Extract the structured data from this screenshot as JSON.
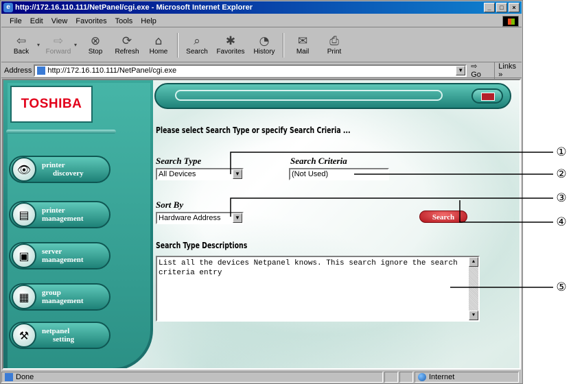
{
  "window": {
    "title": "http://172.16.110.111/NetPanel/cgi.exe - Microsoft Internet Explorer",
    "controls": [
      "_",
      "□",
      "×"
    ]
  },
  "menu": [
    {
      "label": "File",
      "key": "F"
    },
    {
      "label": "Edit",
      "key": "E"
    },
    {
      "label": "View",
      "key": "V"
    },
    {
      "label": "Favorites",
      "key": "a"
    },
    {
      "label": "Tools",
      "key": "T"
    },
    {
      "label": "Help",
      "key": "H"
    }
  ],
  "toolbar": {
    "back": "Back",
    "forward": "Forward",
    "stop": "Stop",
    "refresh": "Refresh",
    "home": "Home",
    "search": "Search",
    "favorites": "Favorites",
    "history": "History",
    "mail": "Mail",
    "print": "Print"
  },
  "address": {
    "label": "Address",
    "url": "http://172.16.110.111/NetPanel/cgi.exe",
    "go": "Go",
    "links": "Links »"
  },
  "logo": "TOSHIBA",
  "nav": [
    {
      "line1": "printer",
      "line2": "discovery",
      "icon": "binoculars-icon",
      "glyph": "👁"
    },
    {
      "line1": "printer",
      "line2": "management",
      "icon": "printer-icon",
      "glyph": "▤"
    },
    {
      "line1": "server",
      "line2": "management",
      "icon": "server-icon",
      "glyph": "▣"
    },
    {
      "line1": "group",
      "line2": "management",
      "icon": "group-icon",
      "glyph": "▦"
    },
    {
      "line1": "netpanel",
      "line2": "setting",
      "icon": "wrench-icon",
      "glyph": "⚒"
    }
  ],
  "main": {
    "prompt": "Please select Search Type or specify Search Crieria ...",
    "search_type_label": "Search Type",
    "search_type_value": "All Devices",
    "search_criteria_label": "Search Criteria",
    "search_criteria_value": "(Not Used)",
    "sort_by_label": "Sort By",
    "sort_by_value": "Hardware Address",
    "search_button": "Search",
    "descriptions_title": "Search Type Descriptions",
    "description_text": "List all the devices Netpanel knows. This search ignore the search criteria entry"
  },
  "status": {
    "left": "Done",
    "zone": "Internet"
  },
  "callouts": [
    "①",
    "②",
    "③",
    "④",
    "⑤"
  ]
}
